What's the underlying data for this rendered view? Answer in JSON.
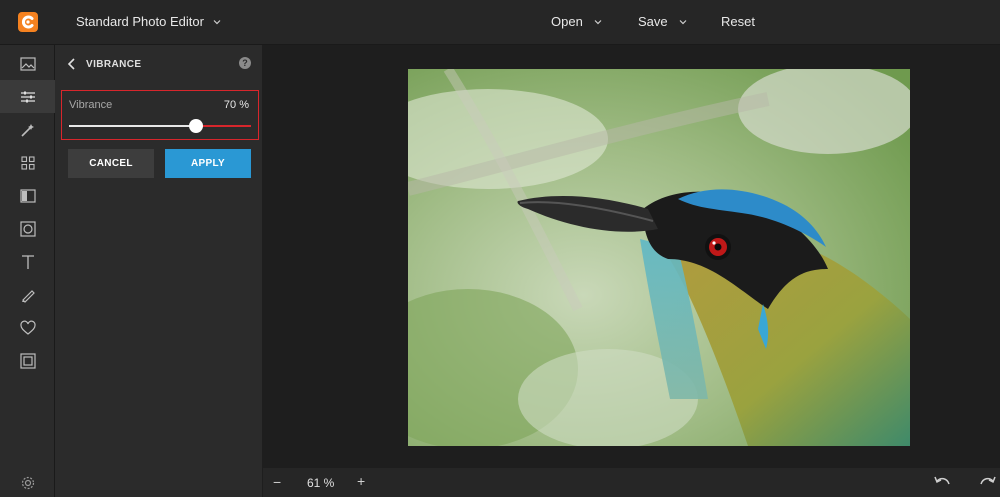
{
  "app": {
    "title": "Standard Photo Editor"
  },
  "menu": {
    "open": "Open",
    "save": "Save",
    "reset": "Reset"
  },
  "colors": {
    "accent": "#2a98d4",
    "highlight": "#d8262c",
    "logo": "#f58220"
  },
  "rail": {
    "items": [
      {
        "icon": "image-icon"
      },
      {
        "icon": "adjustments-icon",
        "active": true
      },
      {
        "icon": "magic-wand-icon"
      },
      {
        "icon": "effects-grid-icon"
      },
      {
        "icon": "frames-icon"
      },
      {
        "icon": "vignette-icon"
      },
      {
        "icon": "text-icon"
      },
      {
        "icon": "draw-icon"
      },
      {
        "icon": "heart-icon"
      },
      {
        "icon": "border-icon"
      },
      {
        "icon": "settings-icon"
      }
    ]
  },
  "panel": {
    "title": "VIBRANCE",
    "help": "?",
    "slider": {
      "label": "Vibrance",
      "value_text": "70 %",
      "fraction": 0.7
    },
    "cancel_label": "CANCEL",
    "apply_label": "APPLY"
  },
  "zoom": {
    "minus": "−",
    "level": "61 %",
    "plus": "+"
  }
}
